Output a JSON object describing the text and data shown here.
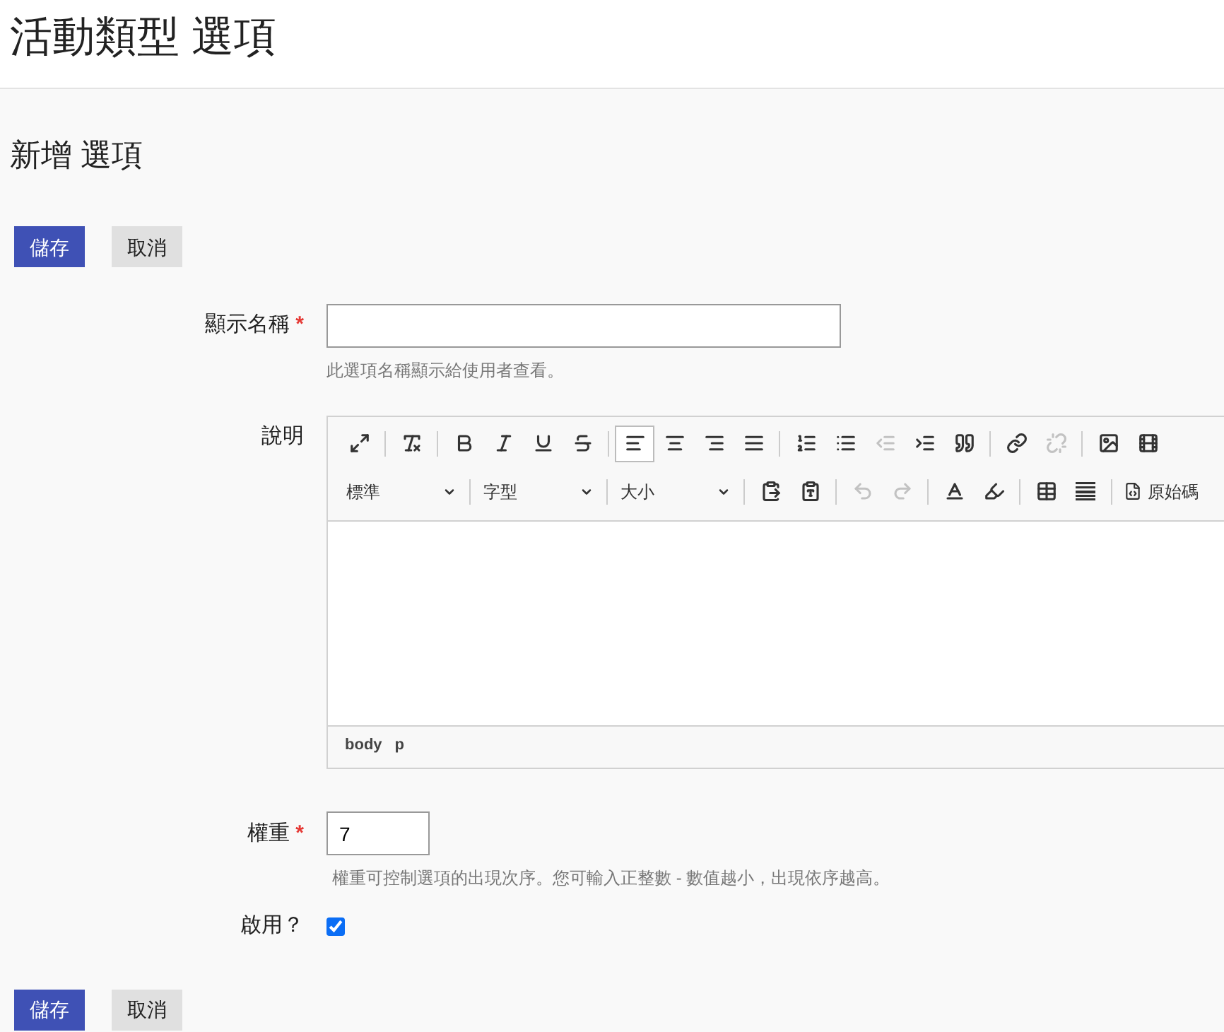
{
  "page_title": "活動類型 選項",
  "form_title": "新增 選項",
  "top_buttons": [
    {
      "label": "儲存",
      "kind": "primary"
    },
    {
      "label": "取消",
      "kind": "secondary"
    }
  ],
  "display_name": {
    "label": "顯示名稱",
    "required_mark": "*",
    "help": "此選項名稱顯示給使用者查看。"
  },
  "description": {
    "label": "說明",
    "toolbar_rows": [
      [
        {
          "kind": "button",
          "disabled": false,
          "selected": false
        },
        {
          "kind": "separator"
        },
        {
          "kind": "button",
          "disabled": false,
          "selected": false
        },
        {
          "kind": "separator"
        },
        {
          "kind": "button",
          "disabled": false,
          "selected": false
        },
        {
          "kind": "button",
          "disabled": false,
          "selected": false
        },
        {
          "kind": "button",
          "disabled": false,
          "selected": false
        },
        {
          "kind": "button",
          "disabled": false,
          "selected": false
        },
        {
          "kind": "separator"
        },
        {
          "kind": "button",
          "disabled": false,
          "selected": true
        },
        {
          "kind": "button",
          "disabled": false,
          "selected": false
        },
        {
          "kind": "button",
          "disabled": false,
          "selected": false
        },
        {
          "kind": "button",
          "disabled": false,
          "selected": false
        },
        {
          "kind": "separator"
        },
        {
          "kind": "button",
          "disabled": false,
          "selected": false
        },
        {
          "kind": "button",
          "disabled": false,
          "selected": false
        },
        {
          "kind": "button",
          "disabled": true,
          "selected": false
        },
        {
          "kind": "button",
          "disabled": false,
          "selected": false
        },
        {
          "kind": "button",
          "disabled": false,
          "selected": false
        },
        {
          "kind": "separator"
        },
        {
          "kind": "button",
          "disabled": false,
          "selected": false
        },
        {
          "kind": "button",
          "disabled": true,
          "selected": false
        },
        {
          "kind": "separator"
        },
        {
          "kind": "button",
          "disabled": false,
          "selected": false
        },
        {
          "kind": "button",
          "disabled": false,
          "selected": false
        }
      ],
      [
        {
          "kind": "dropdown",
          "label": "標準"
        },
        {
          "kind": "separator"
        },
        {
          "kind": "dropdown",
          "label": "字型"
        },
        {
          "kind": "separator"
        },
        {
          "kind": "dropdown",
          "label": "大小"
        },
        {
          "kind": "separator"
        },
        {
          "kind": "button",
          "disabled": false,
          "selected": false
        },
        {
          "kind": "button",
          "disabled": false,
          "selected": false
        },
        {
          "kind": "separator"
        },
        {
          "kind": "button",
          "disabled": true,
          "selected": false
        },
        {
          "kind": "button",
          "disabled": true,
          "selected": false
        },
        {
          "kind": "separator"
        },
        {
          "kind": "button",
          "disabled": false,
          "selected": false
        },
        {
          "kind": "button",
          "disabled": false,
          "selected": false
        },
        {
          "kind": "separator"
        },
        {
          "kind": "button",
          "disabled": false,
          "selected": false
        },
        {
          "kind": "button",
          "disabled": false,
          "selected": false
        },
        {
          "kind": "separator"
        },
        {
          "kind": "labeled",
          "label": "原始碼",
          "disabled": false
        }
      ]
    ],
    "path": [
      "body",
      "p"
    ]
  },
  "weight": {
    "label": "權重",
    "required_mark": "*",
    "value": "7",
    "help": "權重可控制選項的出現次序。您可輸入正整數 - 數值越小，出現依序越高。"
  },
  "enabled": {
    "label": "啟用？",
    "checked": true
  },
  "bottom_buttons": [
    {
      "label": "儲存",
      "kind": "primary"
    },
    {
      "label": "取消",
      "kind": "secondary"
    }
  ]
}
